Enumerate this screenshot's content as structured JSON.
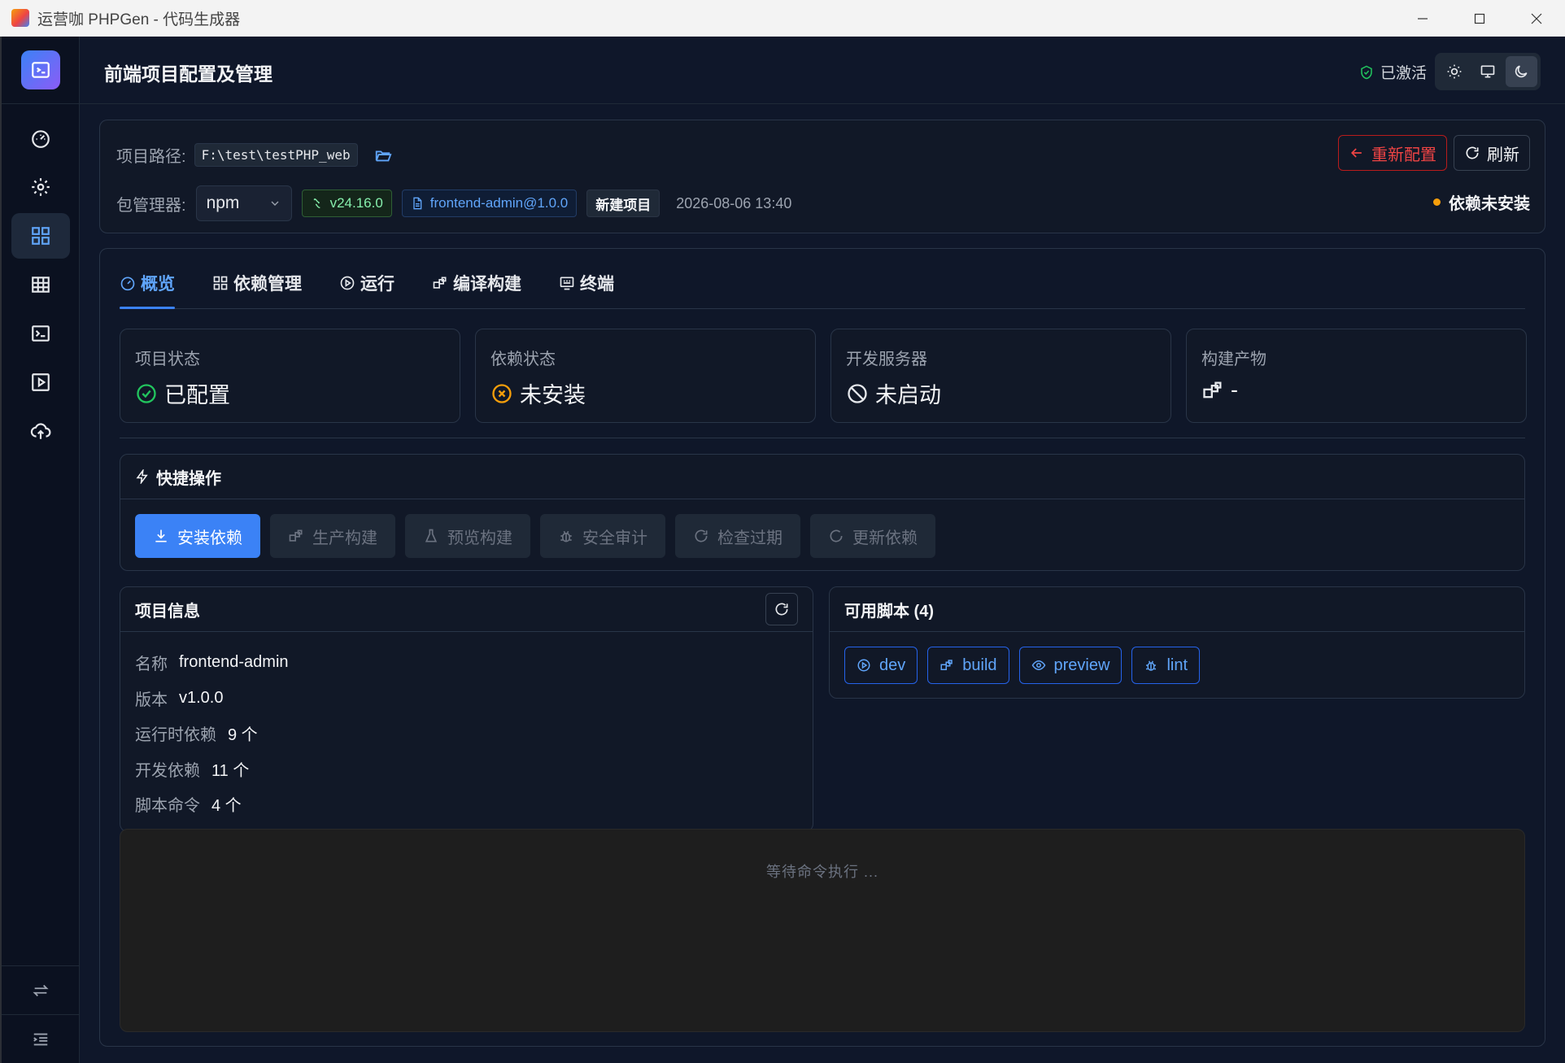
{
  "window": {
    "title": "运营咖 PHPGen - 代码生成器"
  },
  "header": {
    "title": "前端项目配置及管理",
    "activation": "已激活"
  },
  "config": {
    "path_label": "项目路径:",
    "path_value": "F:\\test\\testPHP_web",
    "pm_label": "包管理器:",
    "pm_value": "npm",
    "node_version": "v24.16.0",
    "package": "frontend-admin@1.0.0",
    "project_tag": "新建项目",
    "datetime": "2026-08-06 13:40",
    "reconfig_label": "重新配置",
    "refresh_label": "刷新",
    "dep_status": "依赖未安装",
    "colors": {
      "warning": "#f59e0b",
      "danger": "#ef4444",
      "accent": "#3b82f6",
      "success": "#22c55e"
    }
  },
  "tabs": [
    {
      "label": "概览",
      "icon": "dashboard-icon",
      "active": true
    },
    {
      "label": "依赖管理",
      "icon": "grid-icon"
    },
    {
      "label": "运行",
      "icon": "play-icon"
    },
    {
      "label": "编译构建",
      "icon": "build-icon"
    },
    {
      "label": "终端",
      "icon": "terminal-icon"
    }
  ],
  "stats": [
    {
      "label": "项目状态",
      "value": "已配置",
      "icon": "check-circle-icon"
    },
    {
      "label": "依赖状态",
      "value": "未安装",
      "icon": "x-circle-icon"
    },
    {
      "label": "开发服务器",
      "value": "未启动",
      "icon": "ban-icon"
    },
    {
      "label": "构建产物",
      "value": "-",
      "icon": "build-icon"
    }
  ],
  "quick": {
    "title": "快捷操作",
    "buttons": [
      {
        "label": "安装依赖",
        "icon": "download-icon",
        "primary": true
      },
      {
        "label": "生产构建",
        "icon": "build-icon"
      },
      {
        "label": "预览构建",
        "icon": "flask-icon"
      },
      {
        "label": "安全审计",
        "icon": "bug-icon"
      },
      {
        "label": "检查过期",
        "icon": "refresh-icon"
      },
      {
        "label": "更新依赖",
        "icon": "refresh-icon"
      }
    ]
  },
  "info": {
    "title": "项目信息",
    "rows": [
      {
        "k": "名称",
        "v": "frontend-admin"
      },
      {
        "k": "版本",
        "v": "v1.0.0"
      },
      {
        "k": "运行时依赖",
        "v": "9 个"
      },
      {
        "k": "开发依赖",
        "v": "11 个"
      },
      {
        "k": "脚本命令",
        "v": "4 个"
      }
    ]
  },
  "scripts": {
    "title": "可用脚本 (4)",
    "items": [
      {
        "label": "dev",
        "icon": "play-icon"
      },
      {
        "label": "build",
        "icon": "build-icon"
      },
      {
        "label": "preview",
        "icon": "eye-icon"
      },
      {
        "label": "lint",
        "icon": "bug-icon"
      }
    ]
  },
  "terminal": {
    "placeholder": "等待命令执行 ..."
  }
}
